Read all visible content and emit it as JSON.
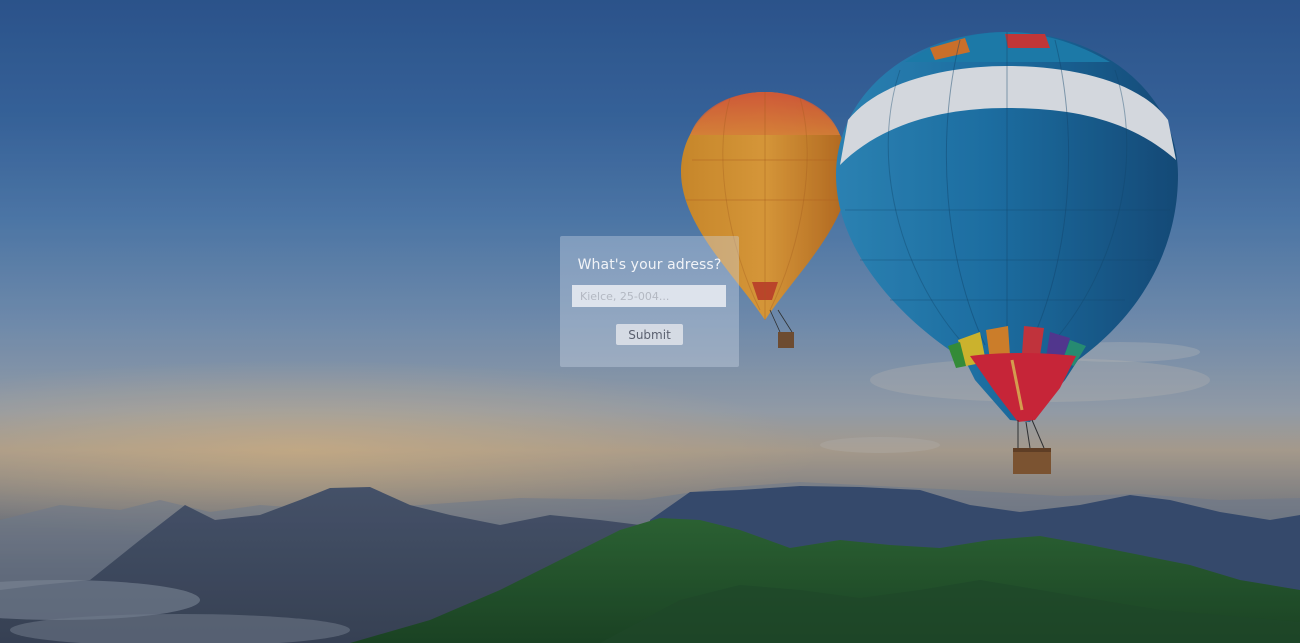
{
  "form": {
    "title": "What's your adress?",
    "address_placeholder": "Kielce, 25-004...",
    "address_value": "",
    "submit_label": "Submit"
  }
}
